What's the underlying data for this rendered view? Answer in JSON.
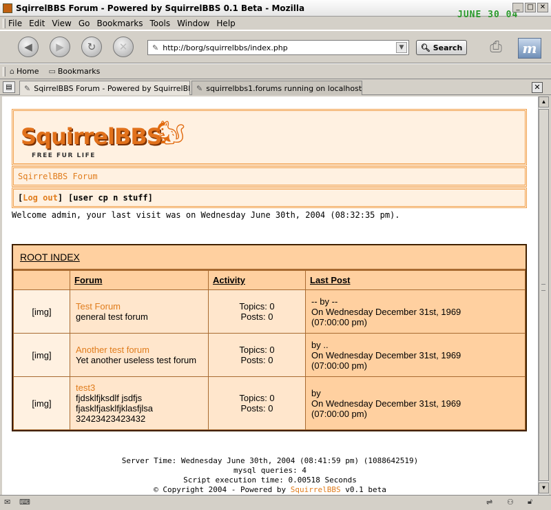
{
  "window": {
    "title": "SqirrelBBS Forum - Powered by SquirrelBBS 0.1 Beta - Mozilla",
    "clock": "JUNE 30 04"
  },
  "menu": {
    "items": [
      "File",
      "Edit",
      "View",
      "Go",
      "Bookmarks",
      "Tools",
      "Window",
      "Help"
    ]
  },
  "toolbar": {
    "url": "http://borg/squirrelbbs/index.php",
    "search_label": "Search"
  },
  "personal_bar": {
    "home_label": "Home",
    "bookmarks_label": "Bookmarks"
  },
  "tabs": [
    {
      "label": "SqirrelBBS Forum - Powered by SquirrelBBS..."
    },
    {
      "label": "squirrelbbs1.forums running on localhost - ..."
    }
  ],
  "page": {
    "logo_text": "SquirrelBBS",
    "logo_tagline": "FREE FUR LIFE",
    "forum_name": "SqirrelBBS Forum",
    "user_links": {
      "open1": "[",
      "logout": "Log out",
      "close1": "]",
      "usercp": "[user cp n stuff]"
    },
    "welcome": "Welcome admin, your last visit was on Wednesday June 30th, 2004 (08:32:35 pm).",
    "index_title": "ROOT INDEX",
    "columns": {
      "forum": "Forum",
      "activity": "Activity",
      "last_post": "Last Post"
    },
    "forums": [
      {
        "img": "[img]",
        "name": "Test Forum",
        "desc": "general test forum",
        "topics": "Topics: 0",
        "posts": "Posts: 0",
        "last_by": "-- by --",
        "last_date": "On Wednesday December 31st, 1969",
        "last_time": "(07:00:00 pm)"
      },
      {
        "img": "[img]",
        "name": "Another test forum",
        "desc": "Yet another useless test forum",
        "topics": "Topics: 0",
        "posts": "Posts: 0",
        "last_by": "by ..",
        "last_date": "On Wednesday December 31st, 1969",
        "last_time": "(07:00:00 pm)"
      },
      {
        "img": "[img]",
        "name": "test3",
        "desc": "fjdsklfjksdlf jsdfjs fjasklfjasklfjklasfjlsa 32423423423432",
        "topics": "Topics: 0",
        "posts": "Posts: 0",
        "last_by": "by",
        "last_date": "On Wednesday December 31st, 1969",
        "last_time": "(07:00:00 pm)"
      }
    ],
    "footer": {
      "server_time": "Server Time: Wednesday June 30th, 2004 (08:41:59 pm) (1088642519)",
      "mysql": "mysql queries: 4",
      "exec": "Script execution time: 0.00518 Seconds",
      "copy_pre": "© Copyright 2004 - Powered by",
      "copy_link": "SquirrelBBS",
      "copy_post": "v0.1 beta"
    }
  }
}
